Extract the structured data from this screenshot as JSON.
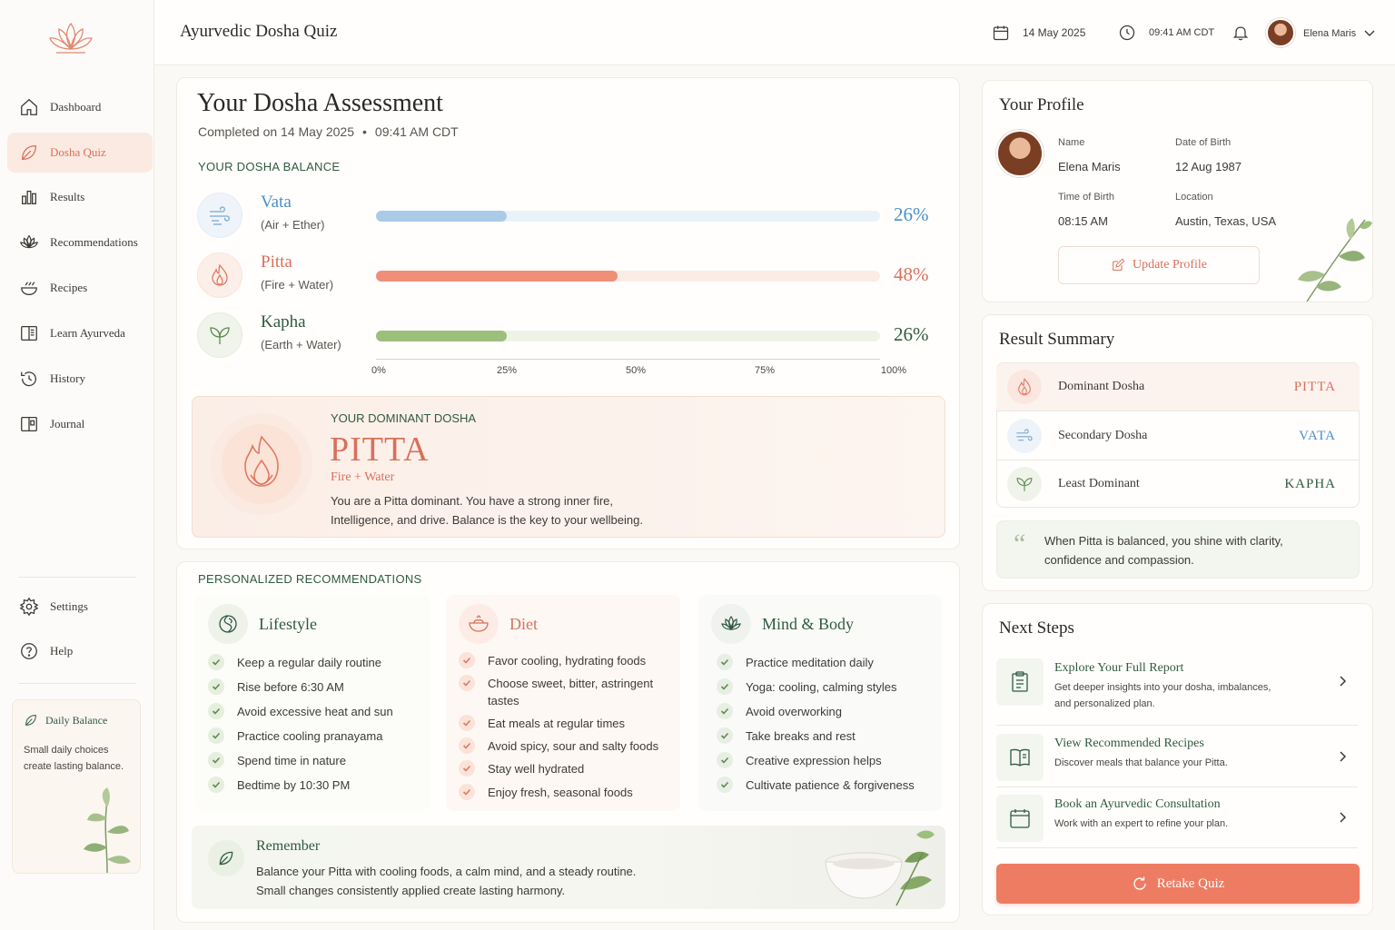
{
  "app": {
    "title": "Ayurvedic Dosha Quiz"
  },
  "header": {
    "date": "14 May 2025",
    "time": "09:41 AM CDT",
    "user_name": "Elena Maris"
  },
  "sidebar": {
    "items": [
      {
        "label": "Dashboard",
        "icon": "home-icon"
      },
      {
        "label": "Dosha Quiz",
        "icon": "leaf-icon",
        "active": true
      },
      {
        "label": "Results",
        "icon": "bar-chart-icon"
      },
      {
        "label": "Recommendations",
        "icon": "lotus-icon"
      },
      {
        "label": "Recipes",
        "icon": "bowl-icon"
      },
      {
        "label": "Learn Ayurveda",
        "icon": "book-icon"
      },
      {
        "label": "History",
        "icon": "history-icon"
      },
      {
        "label": "Journal",
        "icon": "journal-icon"
      }
    ],
    "bottom_items": [
      {
        "label": "Settings",
        "icon": "gear-icon"
      },
      {
        "label": "Help",
        "icon": "help-icon"
      }
    ],
    "balance_card": {
      "title": "Daily Balance",
      "text": "Small daily choices create lasting balance."
    }
  },
  "assessment": {
    "title": "Your Dosha Assessment",
    "completed_prefix": "Completed on 14 May 2025",
    "completed_time": "09:41 AM CDT",
    "balance_label": "YOUR DOSHA BALANCE",
    "doshas": [
      {
        "name": "Vata",
        "elements": "(Air + Ether)",
        "percent": 26,
        "percent_label": "26%",
        "color": "#4a8fc7",
        "fill": "#a9cbe8",
        "track": "#eaf2f9"
      },
      {
        "name": "Pitta",
        "elements": "(Fire + Water)",
        "percent": 48,
        "percent_label": "48%",
        "color": "#d9705a",
        "fill": "#ef8f78",
        "track": "#fcece6"
      },
      {
        "name": "Kapha",
        "elements": "(Earth + Water)",
        "percent": 26,
        "percent_label": "26%",
        "color": "#2f5a3e",
        "fill": "#9dbf7c",
        "track": "#eef3e8"
      }
    ],
    "axis_ticks": [
      "0%",
      "25%",
      "50%",
      "75%",
      "100%"
    ],
    "dominant": {
      "label": "YOUR DOMINANT DOSHA",
      "name": "PITTA",
      "elements": "Fire + Water",
      "desc_line1": "You are a Pitta dominant. You have a strong inner fire,",
      "desc_line2": "Intelligence, and drive. Balance is the key to your wellbeing."
    }
  },
  "recommendations": {
    "label": "PERSONALIZED RECOMMENDATIONS",
    "lifestyle": {
      "title": "Lifestyle",
      "items": [
        "Keep a regular daily routine",
        "Rise before 6:30 AM",
        "Avoid excessive heat and sun",
        "Practice cooling pranayama",
        "Spend time in nature",
        "Bedtime by 10:30 PM"
      ]
    },
    "diet": {
      "title": "Diet",
      "items": [
        "Favor cooling, hydrating foods",
        "Choose sweet, bitter, astringent tastes",
        "Eat meals at regular times",
        "Avoid spicy, sour and salty foods",
        "Stay well hydrated",
        "Enjoy fresh, seasonal foods"
      ]
    },
    "mind_body": {
      "title": "Mind & Body",
      "items": [
        "Practice meditation daily",
        "Yoga: cooling, calming styles",
        "Avoid overworking",
        "Take breaks and rest",
        "Creative expression helps",
        "Cultivate patience & forgiveness"
      ]
    },
    "remember": {
      "title": "Remember",
      "line1": "Balance your Pitta with cooling foods, a calm mind, and a steady routine.",
      "line2": "Small changes consistently applied create lasting harmony."
    }
  },
  "profile": {
    "title": "Your Profile",
    "name_label": "Name",
    "name": "Elena Maris",
    "dob_label": "Date of Birth",
    "dob": "12 Aug 1987",
    "tob_label": "Time of Birth",
    "tob": "08:15 AM",
    "location_label": "Location",
    "location": "Austin, Texas, USA",
    "update_button": "Update Profile"
  },
  "summary": {
    "title": "Result Summary",
    "rows": [
      {
        "label": "Dominant Dosha",
        "value": "PITTA",
        "color": "#d9705a"
      },
      {
        "label": "Secondary Dosha",
        "value": "VATA",
        "color": "#4a8fc7"
      },
      {
        "label": "Least Dominant",
        "value": "KAPHA",
        "color": "#2f5a3e"
      }
    ],
    "quote_line1": "When Pitta is balanced, you shine with clarity,",
    "quote_line2": "confidence and compassion."
  },
  "next_steps": {
    "title": "Next Steps",
    "steps": [
      {
        "title": "Explore Your Full Report",
        "desc1": "Get deeper insights into your dosha, imbalances,",
        "desc2": "and personalized plan."
      },
      {
        "title": "View Recommended Recipes",
        "desc1": "Discover meals that balance your Pitta.",
        "desc2": ""
      },
      {
        "title": "Book an Ayurvedic Consultation",
        "desc1": "Work with an expert to refine your plan.",
        "desc2": ""
      }
    ],
    "retake_button": "Retake Quiz"
  },
  "colors": {
    "accent": "#ee7c62",
    "pitta": "#d9705a",
    "vata": "#4a8fc7",
    "kapha": "#2f5a3e",
    "green_text": "#2f5a3e"
  }
}
